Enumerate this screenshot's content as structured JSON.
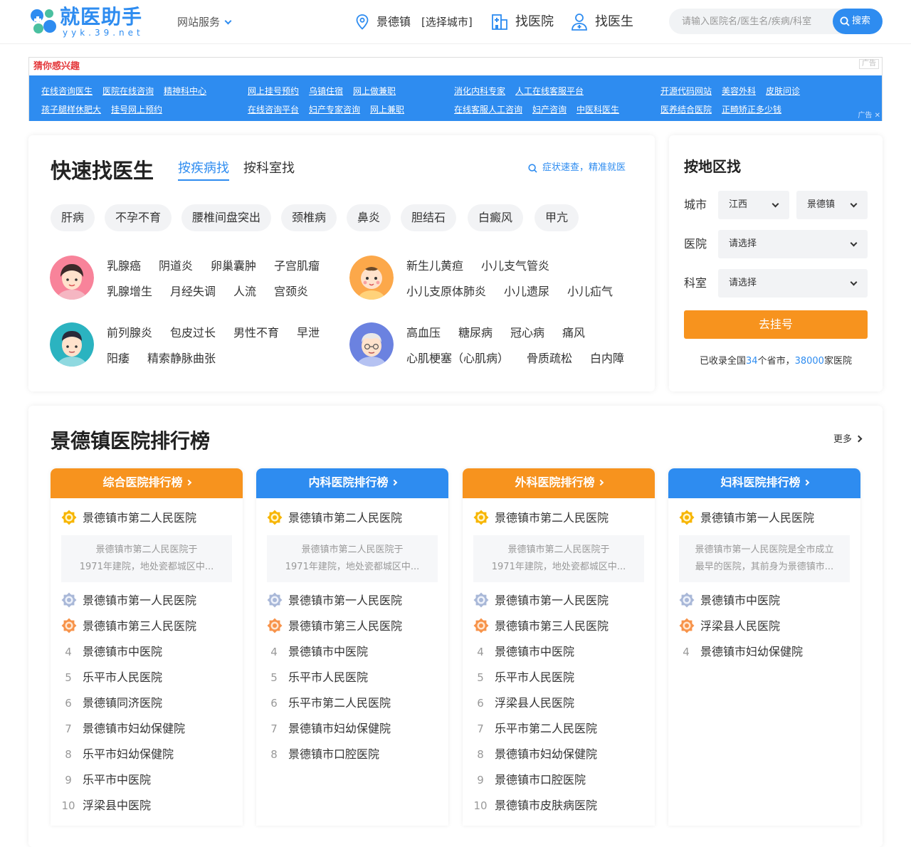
{
  "header": {
    "logo_text": "就医助手",
    "logo_sub": "yyk.39.net",
    "site_service": "网站服务",
    "location_city": "景德镇",
    "location_select": "[选择城市]",
    "nav": [
      "找医院",
      "找医生"
    ],
    "search_placeholder": "请输入医院名/医生名/疾病/科室",
    "search_button": "搜索"
  },
  "ad": {
    "title": "猜你感兴趣",
    "tag": "广告",
    "foot": "广告",
    "columns": [
      [
        [
          "在线咨询医生",
          "医院在线咨询",
          "精神科中心"
        ],
        [
          "孩子腿样休肥大",
          "挂号网上预约"
        ]
      ],
      [
        [
          "网上挂号预约",
          "乌镇住宿",
          "网上做兼职"
        ],
        [
          "在线咨询平台",
          "妇产专家咨询",
          "网上兼职"
        ]
      ],
      [
        [
          "消化内科专家",
          "人工在线客服平台"
        ],
        [
          "在线客服人工咨询",
          "妇产咨询",
          "中医科医生"
        ]
      ],
      [
        [
          "开源代码网站",
          "美容外科",
          "皮肤问诊"
        ],
        [
          "医养结合医院",
          "正畸矫正多少钱"
        ]
      ]
    ]
  },
  "quick": {
    "title": "快速找医生",
    "tabs": [
      "按疾病找",
      "按科室找"
    ],
    "symptom_link": "症状速查，精准就医",
    "pills": [
      "肝病",
      "不孕不育",
      "腰椎间盘突出",
      "颈椎病",
      "鼻炎",
      "胆结石",
      "白癜风",
      "甲亢"
    ],
    "groups": [
      {
        "avatar": "woman-avatar",
        "rows": [
          [
            "乳腺癌",
            "阴道炎",
            "卵巢囊肿",
            "子宫肌瘤"
          ],
          [
            "乳腺增生",
            "月经失调",
            "人流",
            "宫颈炎"
          ]
        ]
      },
      {
        "avatar": "child-avatar",
        "rows": [
          [
            "新生儿黄疸",
            "小儿支气管炎"
          ],
          [
            "小儿支原体肺炎",
            "小儿遗尿",
            "小儿疝气"
          ]
        ]
      },
      {
        "avatar": "man-avatar",
        "rows": [
          [
            "前列腺炎",
            "包皮过长",
            "男性不育",
            "早泄"
          ],
          [
            "阳痿",
            "精索静脉曲张"
          ]
        ]
      },
      {
        "avatar": "elder-avatar",
        "rows": [
          [
            "高血压",
            "糖尿病",
            "冠心病",
            "痛风"
          ],
          [
            "心肌梗塞（心肌病）",
            "骨质疏松",
            "白内障"
          ]
        ]
      }
    ]
  },
  "region": {
    "title": "按地区找",
    "labels": [
      "城市",
      "医院",
      "科室"
    ],
    "province": "江西",
    "city": "景德镇",
    "hospital_placeholder": "请选择",
    "dept_placeholder": "请选择",
    "go_button": "去挂号",
    "stats_prefix": "已收录全国",
    "stats_provinces": "34",
    "stats_mid": "个省市，",
    "stats_hospitals": "38000",
    "stats_suffix": "家医院"
  },
  "rank": {
    "title": "景德镇医院排行榜",
    "more": "更多",
    "columns": [
      {
        "title": "综合医院排行榜",
        "color": "#f7931e",
        "items": [
          "景德镇市第二人民医院",
          "景德镇市第一人民医院",
          "景德镇市第三人民医院",
          "景德镇市中医院",
          "乐平市人民医院",
          "景德镇同济医院",
          "景德镇市妇幼保健院",
          "乐平市妇幼保健院",
          "乐平市中医院",
          "浮梁县中医院"
        ],
        "desc": [
          "景德镇市第二人民医院于",
          "1971年建院，地处瓷都城区中..."
        ]
      },
      {
        "title": "内科医院排行榜",
        "color": "#2e8cf0",
        "items": [
          "景德镇市第二人民医院",
          "景德镇市第一人民医院",
          "景德镇市第三人民医院",
          "景德镇市中医院",
          "乐平市人民医院",
          "乐平市第二人民医院",
          "景德镇市妇幼保健院",
          "景德镇市口腔医院"
        ],
        "desc": [
          "景德镇市第二人民医院于",
          "1971年建院，地处瓷都城区中..."
        ]
      },
      {
        "title": "外科医院排行榜",
        "color": "#f7931e",
        "items": [
          "景德镇市第二人民医院",
          "景德镇市第一人民医院",
          "景德镇市第三人民医院",
          "景德镇市中医院",
          "乐平市人民医院",
          "浮梁县人民医院",
          "乐平市第二人民医院",
          "景德镇市妇幼保健院",
          "景德镇市口腔医院",
          "景德镇市皮肤病医院"
        ],
        "desc": [
          "景德镇市第二人民医院于",
          "1971年建院，地处瓷都城区中..."
        ]
      },
      {
        "title": "妇科医院排行榜",
        "color": "#2e8cf0",
        "items": [
          "景德镇市第一人民医院",
          "景德镇市中医院",
          "浮梁县人民医院",
          "景德镇市妇幼保健院"
        ],
        "desc": [
          "景德镇市第一人民医院是全市成立",
          "最早的医院，其前身为景德镇市..."
        ]
      }
    ],
    "numbers": [
      "1",
      "2",
      "3",
      "4",
      "5",
      "6",
      "7",
      "8",
      "9",
      "10"
    ]
  }
}
